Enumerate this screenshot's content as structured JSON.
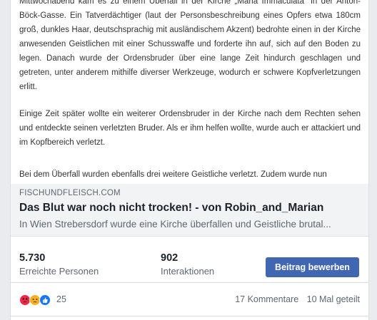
{
  "article": {
    "para1": "Mittwochabend kam es zu einem Überfall in der Kirche „Maria Immaculata“ in der Anton-Böck-Gasse. Ein Tatverdächtiger (laut der Personsbeschreibung eines Opfers etwa 180cm groß, dunkles Haar, deutschsprachig mit ausländischem Akzent) bedrohte einen in der Kirche anwesenden Geistlichen mit einer Schusswaffe und forderte ihn auf, sich auf den Boden zu legen. Danach wurde der Ordensbruder über eine lange Zeit hindurch geschlagen und getreten, unter anderem mithilfe diverser Werkzeuge, wodurch er schwere Kopfverletzungen erlitt.",
    "para2": "Einige Zeit später wollte ein weiterer Ordensbruder in der Kirche nach dem Rechten sehen und entdeckte seinen verletzten Bruder. Als er ihm helfen wollte, wurde auch er attackiert und im Kopfbereich verletzt.",
    "para3": "Bei dem Überfall wurden ebenfalls drei weitere Geistliche verletzt. Zudem wurde nun"
  },
  "preview": {
    "domain": "FISCHUNDFLEISCH.COM",
    "title": "Das Blut war noch nicht trocken! - von Robin_and_Marian",
    "description": "In Wien Strebersdorf wurde eine Kirche überfallen und Geistliche brutal..."
  },
  "stats": {
    "reach_value": "5.730",
    "reach_label": "Erreichte Personen",
    "engagement_value": "902",
    "engagement_label": "Interaktionen",
    "boost_label": "Beitrag bewerben"
  },
  "reactions": {
    "icons": [
      "angry-icon",
      "sad-icon",
      "like-icon"
    ],
    "count": "25",
    "comments": "17 Kommentare",
    "shares": "10 Mal geteilt"
  },
  "colors": {
    "accent": "#4267b2",
    "angry": "#f02849",
    "sad": "#f7b125",
    "like": "#1877f2"
  }
}
